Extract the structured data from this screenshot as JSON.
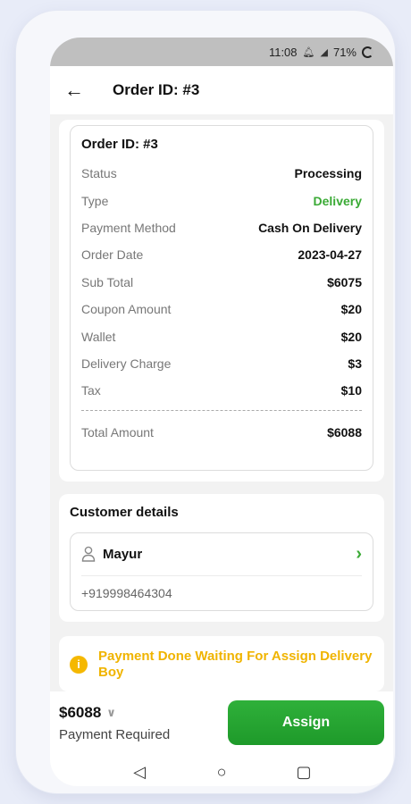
{
  "status_bar": {
    "time": "11:08",
    "battery": "71%"
  },
  "app_bar": {
    "title": "Order ID: #3"
  },
  "order": {
    "title": "Order ID: #3",
    "rows": [
      {
        "label": "Status",
        "value": "Processing"
      },
      {
        "label": "Type",
        "value": "Delivery"
      },
      {
        "label": "Payment Method",
        "value": "Cash On Delivery"
      },
      {
        "label": "Order Date",
        "value": "2023-04-27"
      },
      {
        "label": "Sub Total",
        "value": "$6075"
      },
      {
        "label": "Coupon Amount",
        "value": "$20"
      },
      {
        "label": "Wallet",
        "value": "$20"
      },
      {
        "label": "Delivery Charge",
        "value": "$3"
      },
      {
        "label": "Tax",
        "value": "$10"
      }
    ],
    "total_label": "Total Amount",
    "total_value": "$6088"
  },
  "customer": {
    "section_title": "Customer details",
    "name": "Mayur",
    "phone": "+919998464304"
  },
  "notice": {
    "icon": "info-icon",
    "text": "Payment Done Waiting For Assign Delivery Boy"
  },
  "footer": {
    "amount": "$6088",
    "payment_label": "Payment Required",
    "assign_label": "Assign"
  },
  "colors": {
    "accent": "#3aaa35",
    "warning": "#f5b800"
  }
}
